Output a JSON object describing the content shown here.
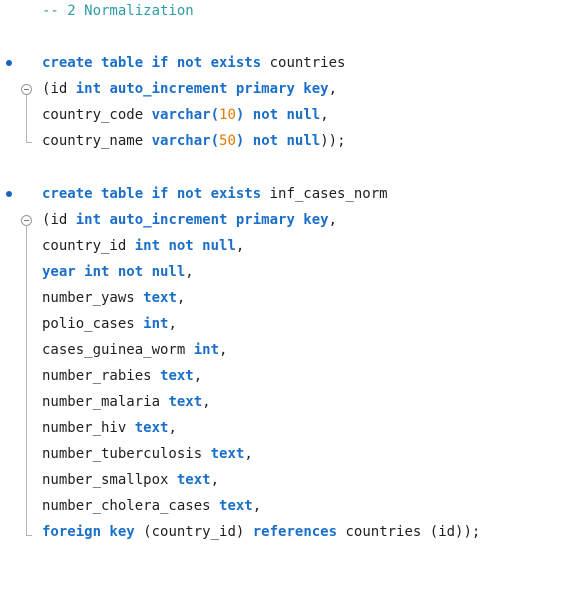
{
  "comment": "-- 2 Normalization",
  "block1": {
    "create": "create table if not exists",
    "table_name": "countries",
    "l2_open": "(",
    "l2_id": "id",
    "l2_kw": "int auto_increment primary key",
    "comma": ",",
    "l3_col": "country_code",
    "varchar": "varchar",
    "lp": "(",
    "l3_len": "10",
    "rp": ")",
    "not_null": "not null",
    "l4_col": "country_name",
    "l4_len": "50",
    "end": "));"
  },
  "block2": {
    "create": "create table if not exists",
    "table_name": "inf_cases_norm",
    "l2_open": "(",
    "l2_id": "id",
    "l2_kw": "int auto_increment primary key",
    "comma": ",",
    "country_id_col": "country_id",
    "int_not_null": "int not null",
    "year_line": "year int not null",
    "cols": [
      {
        "name": "number_yaws",
        "type": "text"
      },
      {
        "name": "polio_cases",
        "type": "int"
      },
      {
        "name": "cases_guinea_worm",
        "type": "int"
      },
      {
        "name": "number_rabies",
        "type": "text"
      },
      {
        "name": "number_malaria",
        "type": "text"
      },
      {
        "name": "number_hiv",
        "type": "text"
      },
      {
        "name": "number_tuberculosis",
        "type": "text"
      },
      {
        "name": "number_smallpox",
        "type": "text"
      },
      {
        "name": "number_cholera_cases",
        "type": "text"
      }
    ],
    "foreign_key": "foreign key",
    "fk_col": "(country_id)",
    "references": "references",
    "fk_target": "countries (id));"
  },
  "colors": {
    "keyword": "#1a6fc9",
    "number": "#e07b00",
    "comment": "#2e9ca6",
    "text": "#1f1f1f",
    "bullet": "#1565c0"
  }
}
